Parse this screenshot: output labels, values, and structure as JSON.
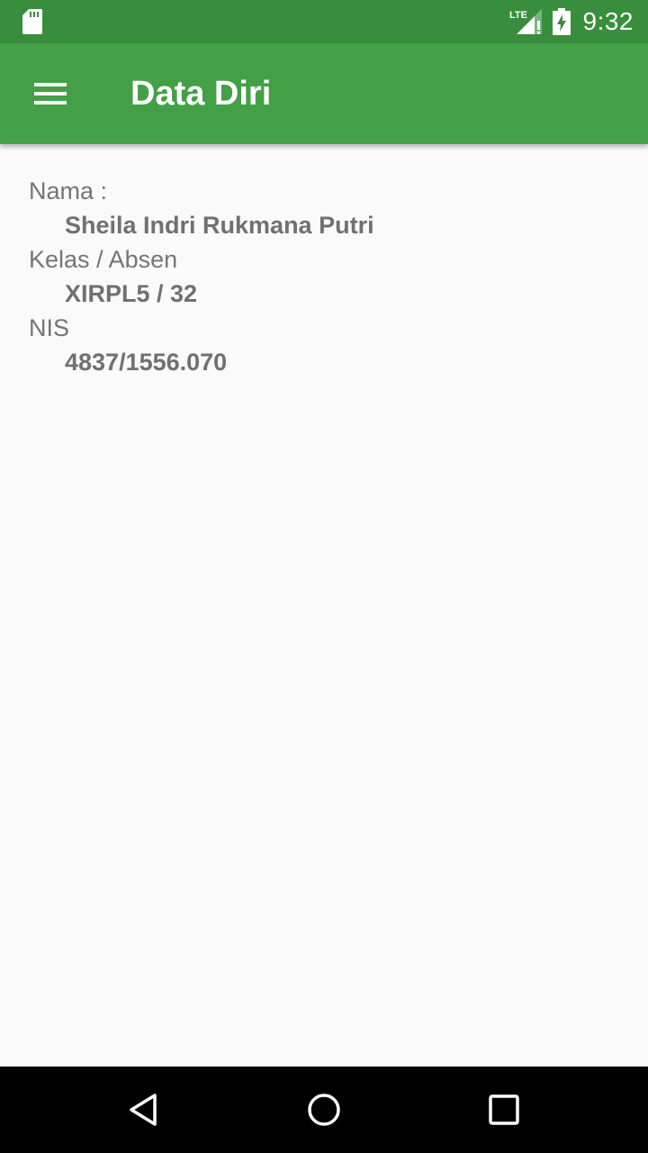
{
  "status_bar": {
    "time": "9:32",
    "network_label": "LTE",
    "icons": [
      "sd-card-icon",
      "lte-signal-icon",
      "battery-charging-icon"
    ],
    "color": "#388e3c"
  },
  "app_bar": {
    "title": "Data Diri",
    "menu_icon": "hamburger-menu-icon",
    "color": "#43a047"
  },
  "profile": {
    "name_label": "Nama :",
    "name_value": "Sheila Indri Rukmana Putri",
    "class_label": "Kelas / Absen",
    "class_value": "XIRPL5 / 32",
    "nis_label": "NIS",
    "nis_value": "4837/1556.070"
  },
  "nav_bar": {
    "buttons": [
      "back-icon",
      "home-icon",
      "recents-icon"
    ]
  },
  "colors": {
    "background": "#fafafa",
    "label_text": "#757575",
    "value_text": "#707070"
  }
}
